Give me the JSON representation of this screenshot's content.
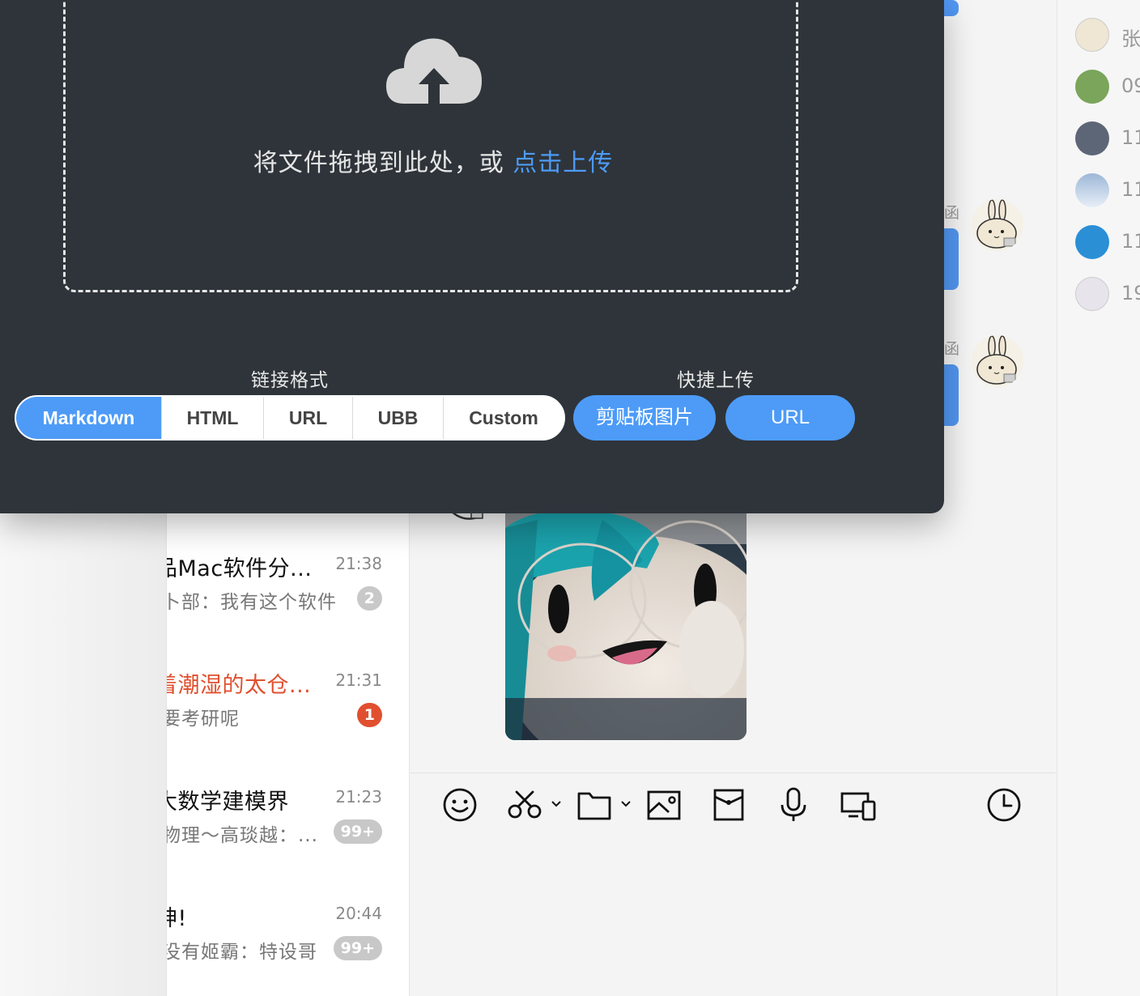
{
  "uploader": {
    "drop_text": "将文件拖拽到此处，或",
    "drop_link": "点击上传",
    "link_format_label": "链接格式",
    "quick_upload_label": "快捷上传",
    "formats": [
      "Markdown",
      "HTML",
      "URL",
      "UBB",
      "Custom"
    ],
    "active_format": "Markdown",
    "quick_buttons": {
      "clipboard": "剪贴板图片",
      "url": "URL"
    },
    "accent_color": "#4d9bf7"
  },
  "conversations": [
    {
      "title": "品Mac软件分...",
      "time": "21:38",
      "preview": "卜部：我有这个软件",
      "badge": "2",
      "highlight": false
    },
    {
      "title": "着潮湿的太仓...",
      "time": "21:31",
      "preview": "要考研呢",
      "badge": "1",
      "highlight": true
    },
    {
      "title": "大数学建模界",
      "time": "21:23",
      "preview": "物理～高琰越：...",
      "badge": "99+",
      "highlight": false
    },
    {
      "title": "神!",
      "time": "20:44",
      "preview": "没有姬霸：特设哥",
      "badge": "99+",
      "highlight": false
    }
  ],
  "chat": {
    "sender_fragment_1": "函",
    "sender_fragment_2": "函"
  },
  "members": [
    {
      "name": "张",
      "avatar_color": "#efe6d4"
    },
    {
      "name": "09",
      "avatar_color": "#7aa55a"
    },
    {
      "name": "11",
      "avatar_color": "#5d6677"
    },
    {
      "name": "11",
      "avatar_color": "#7f9ec8"
    },
    {
      "name": "11",
      "avatar_color": "#2b8fd6"
    },
    {
      "name": "19",
      "avatar_color": "#e8e4ec"
    }
  ],
  "toolbar": {
    "icons": [
      "emoji-icon",
      "scissors-icon",
      "folder-icon",
      "image-icon",
      "red-packet-icon",
      "microphone-icon",
      "screen-share-icon",
      "history-clock-icon"
    ]
  }
}
